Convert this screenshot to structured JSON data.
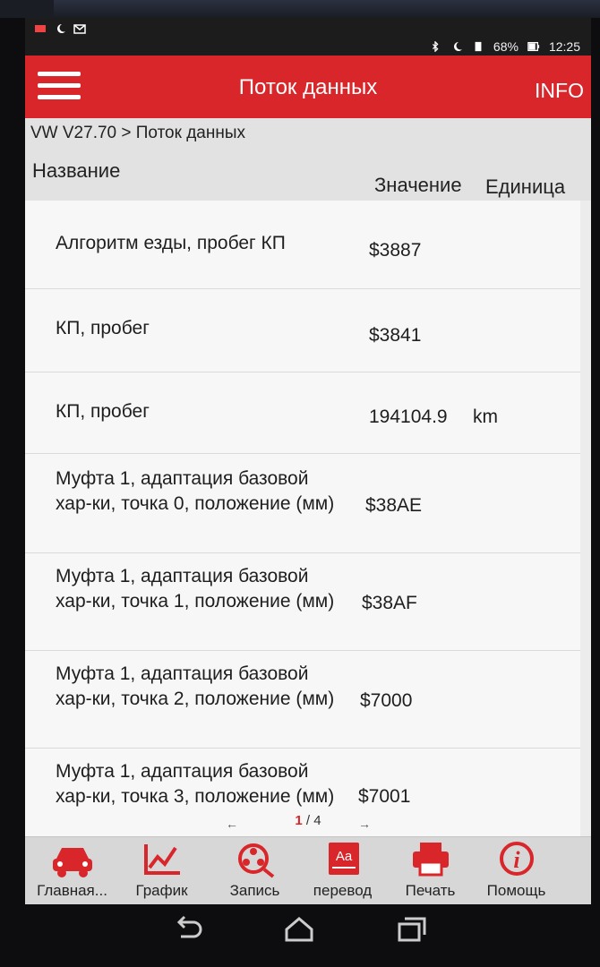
{
  "statusbar": {
    "battery": "68%",
    "time": "12:25"
  },
  "appbar": {
    "title": "Поток данных",
    "info_label": "INFO"
  },
  "breadcrumb": "VW V27.70 > Поток данных",
  "columns": {
    "name": "Название",
    "value": "Значение",
    "unit": "Единица"
  },
  "rows": [
    {
      "name": "Алгоритм езды, пробег КП",
      "value": "$3887",
      "unit": ""
    },
    {
      "name": "КП, пробег",
      "value": "$3841",
      "unit": ""
    },
    {
      "name": "КП, пробег",
      "value": "194104.9",
      "unit": "km"
    },
    {
      "name": "Муфта 1, адаптация базовой хар-ки, точка 0, положение (мм)",
      "value": "$38AE",
      "unit": ""
    },
    {
      "name": "Муфта 1, адаптация базовой хар-ки, точка 1, положение (мм)",
      "value": "$38AF",
      "unit": ""
    },
    {
      "name": "Муфта 1, адаптация базовой хар-ки, точка 2, положение (мм)",
      "value": "$7000",
      "unit": ""
    },
    {
      "name": "Муфта 1, адаптация базовой хар-ки, точка 3, положение (мм)",
      "value": "$7001",
      "unit": ""
    }
  ],
  "pager": {
    "current": "1",
    "total": "/ 4"
  },
  "tabs": [
    {
      "label": "Главная...",
      "icon": "car-icon"
    },
    {
      "label": "График",
      "icon": "chart-icon"
    },
    {
      "label": "Запись",
      "icon": "record-icon"
    },
    {
      "label": "перевод",
      "icon": "translate-icon"
    },
    {
      "label": "Печать",
      "icon": "printer-icon"
    },
    {
      "label": "Помощь",
      "icon": "help-icon"
    }
  ],
  "colors": {
    "accent": "#d8262a",
    "background": "#f7f7f7",
    "bottombar": "#d7d7d7"
  }
}
